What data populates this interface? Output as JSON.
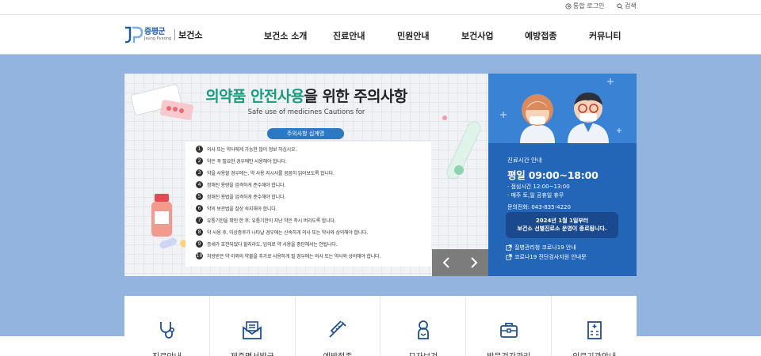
{
  "util": {
    "login_label": "통합 로그인",
    "search_label": "검색"
  },
  "header": {
    "logo": {
      "county": "증평군",
      "english": "Jeung Pyeong",
      "center": "보건소"
    },
    "nav": [
      "보건소 소개",
      "진료안내",
      "민원안내",
      "보건사업",
      "예방접종",
      "커뮤니티"
    ]
  },
  "banner": {
    "title_highlight": "의약품 안전사용",
    "title_rest": "을 위한 주의사항",
    "subtitle": "Safe use of medicines Cautions for",
    "tag": "주의사항 십계명",
    "rules": [
      {
        "num": "1",
        "text": "의사 또는 약사에게 가능한 많이 정보 하십시오."
      },
      {
        "num": "2",
        "text": "약은 꼭 필요한 경우에만 사용해야 합니다."
      },
      {
        "num": "3",
        "text": "약을 사용할 경우에는, 약 사용 지시서를 꼼꼼히 읽어보도록 합니다."
      },
      {
        "num": "4",
        "text": "정해진 용량을 엄격하게 준수해야 합니다."
      },
      {
        "num": "5",
        "text": "정해진 용법을 엄격하게 준수해야 합니다."
      },
      {
        "num": "6",
        "text": "약의 보관법을 잘상 숙지해야 합니다."
      },
      {
        "num": "7",
        "text": "유통기한을 확인 한 후, 유통기한이 지난 약은 즉시 버리도록 합니다."
      },
      {
        "num": "8",
        "text": "약 사용 후, 이상증후가 나타날 경우에는 신속하게 의사 또는 약사와 상의해야 합니다."
      },
      {
        "num": "9",
        "text": "증세가 호전되었다 할지라도, 임의로 약 사용을 중단해서는 안됩니다."
      },
      {
        "num": "10",
        "text": "처방받은 약 이외의 약물을 추가로 사용하게 될 경우에는 의사 또는 약사와 상의해야 합니다."
      }
    ]
  },
  "side": {
    "label": "진료시간 안내",
    "hours": "평일 09:00~18:00",
    "lunch": "· 점심시간 12:00~13:00",
    "closed": "· 매주 토,일 공휴일 휴무",
    "tel": "문의전화: 043-835-4220",
    "notice_line1": "2024년 1월 1일부터",
    "notice_line2": "보건소 선별진료소 운영이 종료됩니다.",
    "links": [
      "질병관리청 코로나19 안내",
      "코로나19 진단검사지원 안내문"
    ]
  },
  "quick_menu": [
    {
      "icon": "stethoscope-icon",
      "label": "진료안내"
    },
    {
      "icon": "mail-icon",
      "label": "제증명서발급"
    },
    {
      "icon": "syringe-icon",
      "label": "예방접종"
    },
    {
      "icon": "baby-icon",
      "label": "모자보건"
    },
    {
      "icon": "first-aid-kit-icon",
      "label": "방문건강관리"
    },
    {
      "icon": "hospital-building-icon",
      "label": "의료기관안내"
    }
  ],
  "colors": {
    "band": "#93b4df",
    "brand_blue": "#2366b8",
    "highlight_green": "#1b9b7c",
    "tag_blue": "#2c79c3"
  }
}
